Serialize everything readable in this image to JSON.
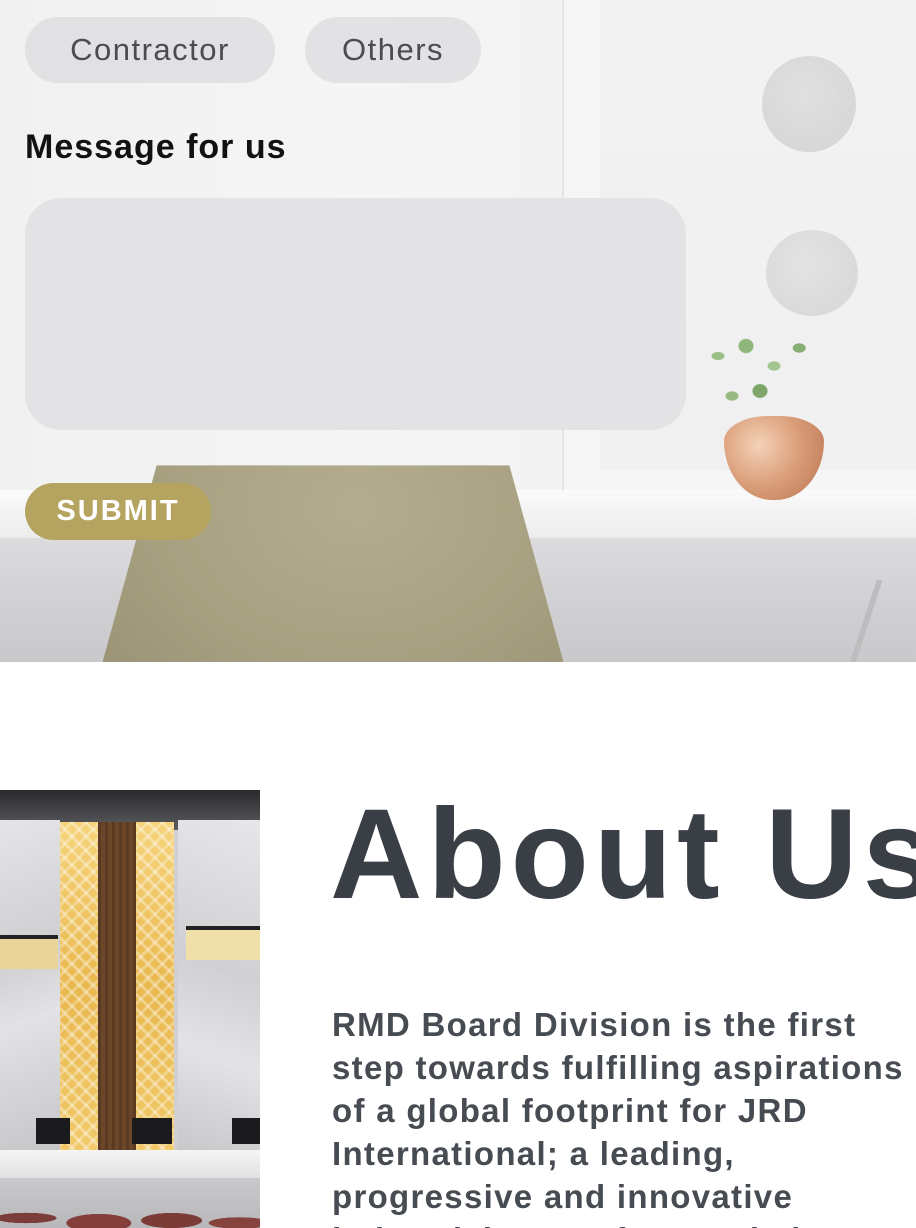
{
  "form": {
    "chips": [
      {
        "label": "Contractor"
      },
      {
        "label": "Others"
      }
    ],
    "message_label": "Message for us",
    "message_value": "",
    "message_placeholder": "",
    "submit_label": "SUBMIT",
    "colors": {
      "chip_bg": "#e0e0e2",
      "submit_bg": "#b5a360",
      "submit_text": "#ffffff"
    }
  },
  "about": {
    "title": "About Us",
    "text": "RMD Board Division is the first step towards fulfilling aspirations of a global footprint for JRD International; a leading, progressive and innovative industrial group from Dubai",
    "colors": {
      "title": "#3a3f46",
      "text": "#474b52"
    }
  }
}
